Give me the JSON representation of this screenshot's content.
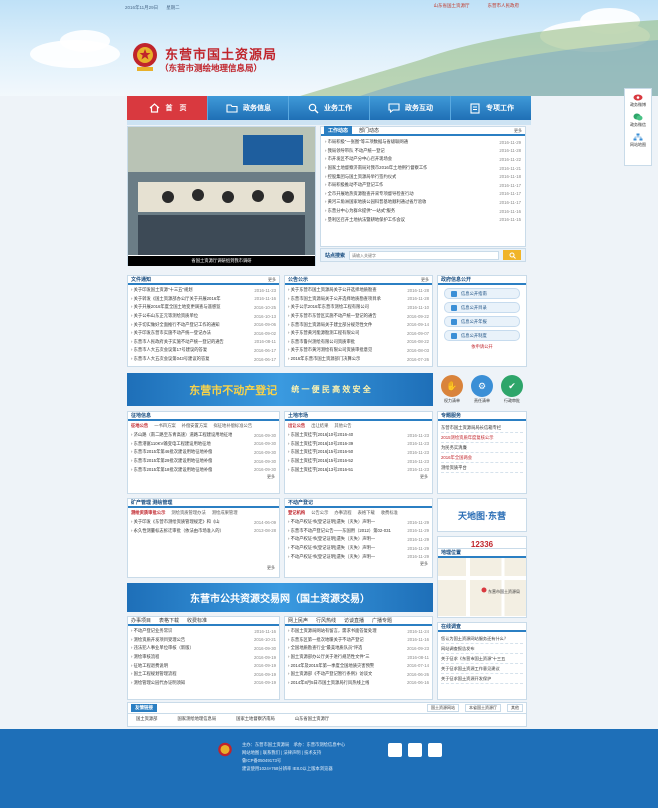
{
  "topbar": {
    "date": "2016年11月29日",
    "weekday": "星期二",
    "link1": "山东省国土资源厅",
    "link2": "东营市人民政府"
  },
  "header": {
    "title": "东营市国土资源局",
    "subtitle": "（东营市测绘地理信息局）"
  },
  "nav": [
    {
      "label": "首　页",
      "icon": "home-icon"
    },
    {
      "label": "政务信息",
      "icon": "folder-icon"
    },
    {
      "label": "业务工作",
      "icon": "search-icon"
    },
    {
      "label": "政务互动",
      "icon": "chat-icon"
    },
    {
      "label": "专项工作",
      "icon": "doc-icon"
    }
  ],
  "float_sidebar": [
    {
      "label": "政务微博",
      "icon": "weibo-icon"
    },
    {
      "label": "政务微信",
      "icon": "wechat-icon"
    },
    {
      "label": "网站地图",
      "icon": "sitemap-icon"
    }
  ],
  "slideshow": {
    "caption": "省国土资源厅调研组到我市调研"
  },
  "work_news": {
    "tabs": [
      "工作动态",
      "部门动态"
    ],
    "more": "更多",
    "items": [
      {
        "text": "市局积极\"一张图\"等三项数据与省级联网通",
        "date": "2016-11-29"
      },
      {
        "text": "我局领导带队 不动产统一登记",
        "date": "2016-11-28"
      },
      {
        "text": "市开发区不动产分中心召开现场会",
        "date": "2016-11-22"
      },
      {
        "text": "国家土地督察济南局对我市2016年土地例行督察工作",
        "date": "2016-11-21"
      },
      {
        "text": "控股集团与国土资源局举行签约仪式",
        "date": "2016-11-18"
      },
      {
        "text": "市局积极推动不动产登记工作",
        "date": "2016-11-17"
      },
      {
        "text": "全市开展地热资源勘查开采专项督导检查行动",
        "date": "2016-11-17"
      },
      {
        "text": "黄河三角洲国家地质公园科普基地顺利通过省厅验收",
        "date": "2016-11-17"
      },
      {
        "text": "东营分中心为群众提供\"一站式\"服务",
        "date": "2016-11-16"
      },
      {
        "text": "垦利区召开土地执法暨耕地保护工作会议",
        "date": "2016-11-15"
      }
    ]
  },
  "site_search": {
    "label": "站点搜索",
    "placeholder": "请输入关键字"
  },
  "notices": {
    "title": "文件通知",
    "more": "更多",
    "items": [
      {
        "text": "关于印发国土资源\"十三五\"规划",
        "date": "2016-11-23"
      },
      {
        "text": "关于转发《国土资源部办公厅关于开展2016年",
        "date": "2016-11-16"
      },
      {
        "text": "关于开展2016年度全国土地变更调查与遥感监",
        "date": "2016-10-25"
      },
      {
        "text": "关于公布山东正元等测绘资质单位",
        "date": "2016-10-13"
      },
      {
        "text": "关于切实做好全面推行不动产登记工作的通知",
        "date": "2016-09-06"
      },
      {
        "text": "关于印发东营市实施不动产统一登记办法",
        "date": "2016-09-02"
      },
      {
        "text": "东营市人民政府关于实施不动产统一登记的通告",
        "date": "2016-08-11"
      },
      {
        "text": "东营市人大五次会议第17号建议的答复",
        "date": "2016-06-17"
      },
      {
        "text": "东营市人大五次会议第043号建议的答复",
        "date": "2016-06-17"
      }
    ]
  },
  "announcements": {
    "title": "公告公示",
    "more": "更多",
    "items": [
      {
        "text": "关于东营市国土资源局关于公开选择地质勘查",
        "date": "2016-11-28"
      },
      {
        "text": "东营市国土资源局关于公开选择地质勘查项目承",
        "date": "2016-11-28"
      },
      {
        "text": "关于公示2016年东营市测绘工程有限公司",
        "date": "2016-11-10"
      },
      {
        "text": "关于东营市东营区实施不动产统一登记的通告",
        "date": "2016-09-22"
      },
      {
        "text": "东营市国土资源局关于建立部分规范性文件",
        "date": "2016-09-14"
      },
      {
        "text": "关于东营黄河能源勘测工程有限公司",
        "date": "2016-09-07"
      },
      {
        "text": "东营市鲁兴测绘有限公司资质审批",
        "date": "2016-08-22"
      },
      {
        "text": "关于东营市黄河测绘有限公司资质审批意见",
        "date": "2016-08-03"
      },
      {
        "text": "2016年东营市国土资源部门决算公示",
        "date": "2016-07-26"
      }
    ]
  },
  "gov_public": {
    "title": "政府信息公开",
    "items": [
      "信息公开指南",
      "信息公开目录",
      "信息公开年报",
      "信息公开制度"
    ],
    "apply": "依申请公开"
  },
  "banner1": {
    "text": "东营市不动产登记",
    "slogan": "统 一 便 民 高 效 安 全"
  },
  "quick_icons": [
    {
      "label": "权力清单",
      "color": "#d9833b"
    },
    {
      "label": "责任清单",
      "color": "#3b8fd6"
    },
    {
      "label": "行政审批",
      "color": "#2ea56a"
    }
  ],
  "zhengji": {
    "title": "征地信息",
    "more": "更多",
    "tabs": [
      "征地公告",
      "一书四方案",
      "补偿安置方案",
      "拟征地补偿标准公告"
    ],
    "items": [
      {
        "text": "济山路（南二路至东青高速）道路工程建设用地征地",
        "date": "2016-09-30"
      },
      {
        "text": "东营港富110KV输变电工程建设用地征地",
        "date": "2016-09-30"
      },
      {
        "text": "东营市2015年第46批次建设用地征地补偿",
        "date": "2016-09-30"
      },
      {
        "text": "东营市2015年第29批次建设用地征地补偿",
        "date": "2016-09-30"
      },
      {
        "text": "东营市2015年第18批次建设用地征地补偿",
        "date": "2016-09-30"
      }
    ]
  },
  "land_market": {
    "title": "土地市场",
    "more": "更多",
    "tabs": [
      "出让公告",
      "出让结果",
      "其他公告"
    ],
    "items": [
      {
        "text": "东国土资挂字[2016]10号2016-40",
        "date": "2016-11-23"
      },
      {
        "text": "东国土资挂字[2016]10号2016-39",
        "date": "2016-11-23"
      },
      {
        "text": "东国土资挂字[2016]15号2016-50",
        "date": "2016-11-23"
      },
      {
        "text": "东国土资挂字[2016]15号2016-52",
        "date": "2016-11-23"
      },
      {
        "text": "东国土资挂字[2016]13号2016-51",
        "date": "2016-11-23"
      }
    ]
  },
  "mining": {
    "title": "矿产管理",
    "title2": "测绘管理",
    "more": "更多",
    "tabs": [
      "测绘资质审批公示",
      "测绘资质管理办法",
      "测绘成果管理"
    ],
    "items": [
      {
        "text": "关于印发《东营市测绘资质管理规定》和《山",
        "date": "2014-06-09"
      },
      {
        "text": "永久性测量标志拆迁审批（依法由市场准入的）",
        "date": "2013-08-28"
      }
    ]
  },
  "realestate": {
    "title": "不动产登记",
    "more": "更多",
    "tabs": [
      "登记机构",
      "公告公示",
      "办事流程",
      "表格下载",
      "收费标准"
    ],
    "items": [
      {
        "text": "不动产权证书(登记证明)遗失（灭失）声明—",
        "date": "2016-11-29"
      },
      {
        "text": "东营市不动产登记公告——东国用（2012）第02-031",
        "date": "2016-11-29"
      },
      {
        "text": "不动产权证书(登记证明)遗失（灭失）声明—",
        "date": "2016-11-29"
      },
      {
        "text": "不动产权证书(登记证明)遗失（灭失）声明—",
        "date": "2016-11-29"
      },
      {
        "text": "不动产权证书(登记证明)遗失（灭失）声明—",
        "date": "2016-11-29"
      }
    ]
  },
  "special": {
    "title": "专题服务",
    "items": [
      "东营市国土资源局局长信箱专栏",
      "2015测绘资质年度复核公示",
      "为民务实清廉",
      "2016年全国两会",
      "测绘资质平台"
    ]
  },
  "ads": {
    "tianditu": "天地图·东营",
    "hotline": "12336",
    "hotline_label": "国土资源违法举报电话"
  },
  "banner2": {
    "text": "东营市公共资源交易网（国土资源交易）"
  },
  "office_guide": {
    "tabs": [
      "办事项目",
      "表格下载",
      "收费标准"
    ],
    "items": [
      {
        "text": "不动产登记业务常识",
        "date": "2016-11-16"
      },
      {
        "text": "测绘资质开发项目受理公告",
        "date": "2016-10-21"
      },
      {
        "text": "违法犯人事业单位审核（新版）",
        "date": "2016-09-30"
      },
      {
        "text": "测绘审核流程",
        "date": "2016-09-19"
      },
      {
        "text": "征地工程退费说明",
        "date": "2016-09-19"
      },
      {
        "text": "国土工程规划管理流程",
        "date": "2016-09-19"
      },
      {
        "text": "测绘管理公园代办证明须知",
        "date": "2016-09-19"
      }
    ]
  },
  "online": {
    "tabs": [
      "网上民声",
      "行风热线",
      "访谈直播",
      "广播专题"
    ],
    "items": [
      {
        "text": "市国土资源局网站有留言，需求书面答复处理",
        "date": "2016-11-24"
      },
      {
        "text": "东营东区第一批次地暖关于不动产登记",
        "date": "2016-11-16"
      },
      {
        "text": "全国地质勘查行业\"最美地质队员\"评选",
        "date": "2016-09-23"
      },
      {
        "text": "国土资源部办公厅关于进行规范性文件\"三",
        "date": "2016-08-11"
      },
      {
        "text": "2014年及2015年第一季度全国地质灾害预警",
        "date": "2016-07-14"
      },
      {
        "text": "国土资源部《不动产登记暂行条例》访谈文",
        "date": "2016-06-26"
      },
      {
        "text": "2014年8月5日市国土资源局行风热线上线",
        "date": "2016-06-16"
      }
    ]
  },
  "map": {
    "title": "地理位置",
    "label": "东营市国土资源局"
  },
  "survey": {
    "title": "在线调查",
    "items": [
      "您认为国土资源网站服务还有什么？",
      "网站调查报告发布",
      "关于征求《东营市国土资源\"十三五",
      "关于征求国土资源工作意见建议",
      "关于征求国土资源开发保护"
    ]
  },
  "friend_links": {
    "title": "友情链接",
    "items": [
      "国土资源部",
      "国家测绘地理信息局",
      "国家土地督察济南局",
      "山东省国土资源厅"
    ],
    "selects": [
      "国土资源网站",
      "本省国土资源厅",
      "其他"
    ]
  },
  "footer": {
    "line1": "主办：东营市国土资源局　承办：东营市测绘信息中心",
    "line2": "网站地图 | 联系我们 | 法律声明 | 技术支持",
    "line3": "鲁ICP备05049173号",
    "line4": "建议使用1024×768分辨率 IE8.0以上版本浏览器"
  }
}
